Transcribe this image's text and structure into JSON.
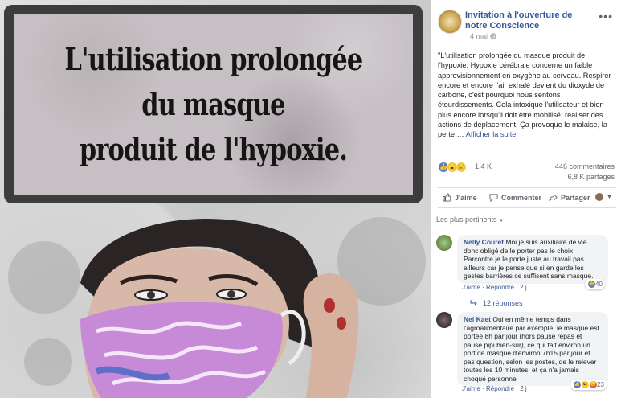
{
  "image": {
    "caption_line1": "L'utilisation prolongée du masque",
    "caption_line2": "produit de l'hypoxie."
  },
  "post": {
    "page_name": "Invitation à l'ouverture de notre Conscience",
    "date": "4 mai",
    "privacy_icon": "globe-icon",
    "more_label": "•••",
    "body": "\"L'utilisation prolongée du masque produit de l'hypoxie. Hypoxie cérébrale concerne un faible approvisionnement en oxygène au cerveau. Respirer encore et encore l'air exhalé devient du dioxyde de carbone, c'est pourquoi nous sentons étourdissements. Cela intoxique l'utilisateur et bien plus encore lorsqu'il doit être mobilisé, réaliser des actions de déplacement. Ça provoque le malaise, la perte …",
    "see_more": "Afficher la suite",
    "reactions_count": "1,4 K",
    "comments_count": "446 commentaires",
    "shares_count": "6,8 K partages"
  },
  "actions": {
    "like": "J'aime",
    "comment": "Commenter",
    "share": "Partager"
  },
  "comments_filter": "Les plus pertinents",
  "comments": [
    {
      "author": "Nelly Couret",
      "text": "Moi je suis auxiliaire de vie donc obligé de le porter pas le choix Parcontre je le porte juste au travail pas ailleurs car je pense que si en garde les gestes barrières ce suffisent sans masque.",
      "like_label": "J'aime",
      "reply_label": "Répondre",
      "age": "2 j",
      "reaction_count": "40"
    },
    {
      "author": "Nel Kaet",
      "text": "Oui en même temps dans l'agroalimentaire par exemple, le masque est portée 8h par jour (hors pause repas et pause pipi bien-sûr), ce qui fait environ un port de masque d'environ 7h15 par jour et pas question, selon les postes, de le relever toutes les 10 minutes, et ça n'a jamais choqué personne",
      "like_label": "J'aime",
      "reply_label": "Répondre",
      "age": "2 j",
      "reaction_count": "23"
    }
  ],
  "replies_label": "12 réponses",
  "colors": {
    "link": "#365899",
    "like_blue": "#4a7bd7",
    "bubble": "#f2f3f5"
  }
}
